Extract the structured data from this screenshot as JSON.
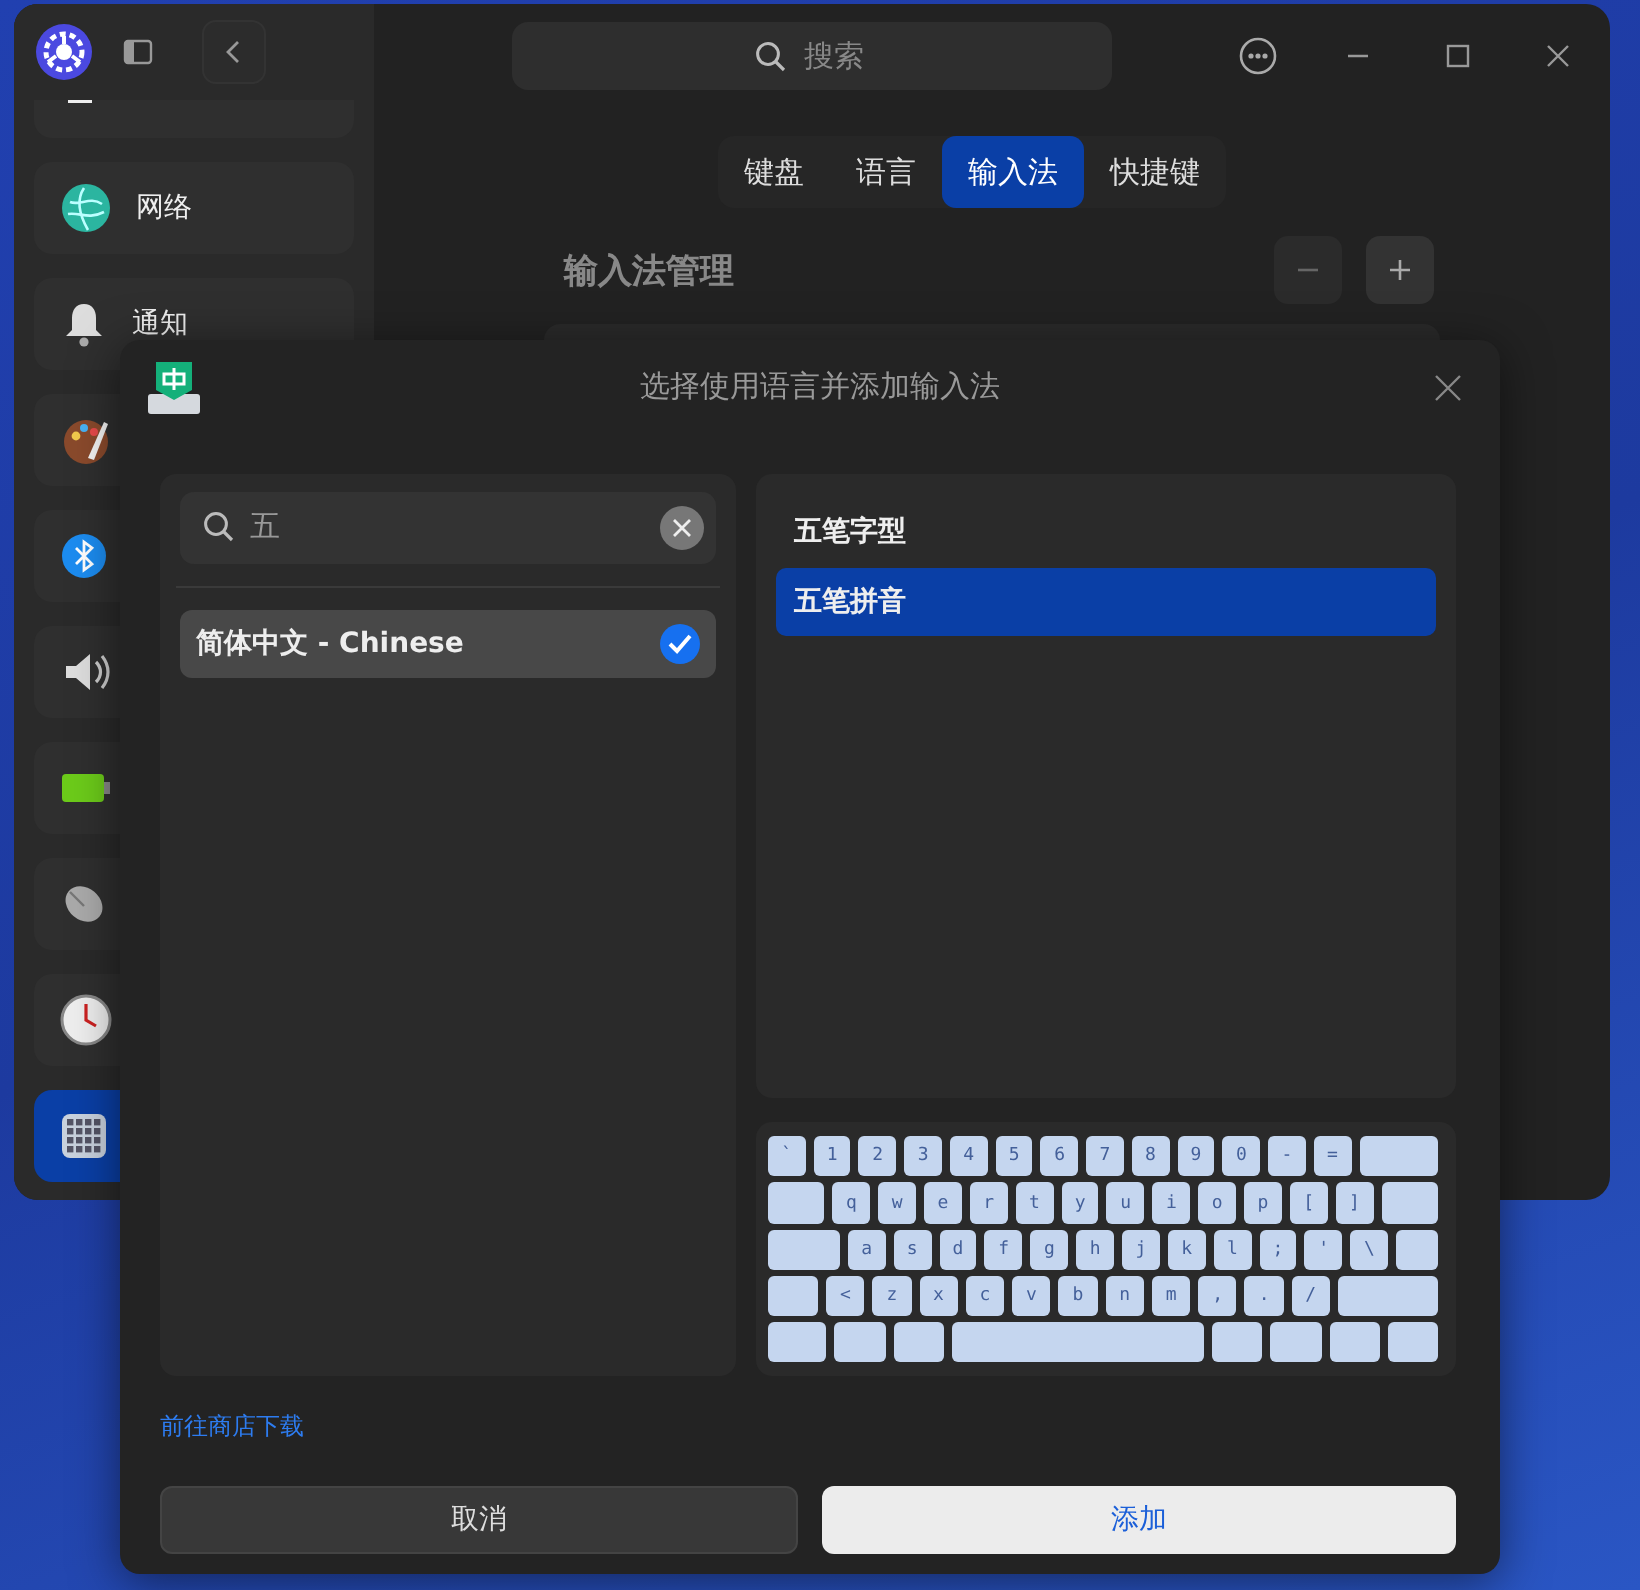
{
  "window": {
    "search": {
      "placeholder": "搜索"
    },
    "sidebar": {
      "items": [
        {
          "kind": "general",
          "selected": false
        },
        {
          "kind": "network",
          "label": "网络",
          "selected": false
        },
        {
          "kind": "notification",
          "label": "通知",
          "selected": false
        },
        {
          "kind": "appearance",
          "selected": false
        },
        {
          "kind": "bluetooth",
          "selected": false
        },
        {
          "kind": "sound",
          "selected": false
        },
        {
          "kind": "power",
          "selected": false
        },
        {
          "kind": "mouse",
          "selected": false
        },
        {
          "kind": "datetime",
          "selected": false
        },
        {
          "kind": "keyboard",
          "selected": true
        }
      ]
    },
    "tabs": [
      {
        "label": "键盘",
        "selected": false
      },
      {
        "label": "语言",
        "selected": false
      },
      {
        "label": "输入法",
        "selected": true
      },
      {
        "label": "快捷键",
        "selected": false
      }
    ],
    "section_title": "输入法管理"
  },
  "dialog": {
    "title": "选择使用语言并添加输入法",
    "search": {
      "value": "五"
    },
    "languages": [
      {
        "label": "简体中文 - Chinese",
        "selected": true,
        "checked": true
      }
    ],
    "input_methods": [
      {
        "label": "五笔字型",
        "selected": false
      },
      {
        "label": "五笔拼音",
        "selected": true
      }
    ],
    "keyboard": {
      "rows": [
        [
          {
            "kind": "key",
            "label": "`"
          },
          {
            "kind": "key",
            "label": "1"
          },
          {
            "kind": "key",
            "label": "2"
          },
          {
            "kind": "key",
            "label": "3"
          },
          {
            "kind": "key",
            "label": "4"
          },
          {
            "kind": "key",
            "label": "5"
          },
          {
            "kind": "key",
            "label": "6"
          },
          {
            "kind": "key",
            "label": "7"
          },
          {
            "kind": "key",
            "label": "8"
          },
          {
            "kind": "key",
            "label": "9"
          },
          {
            "kind": "key",
            "label": "0"
          },
          {
            "kind": "key",
            "label": "-"
          },
          {
            "kind": "key",
            "label": "="
          },
          {
            "kind": "backspace"
          }
        ],
        [
          {
            "kind": "tab"
          },
          {
            "kind": "key",
            "label": "q"
          },
          {
            "kind": "key",
            "label": "w"
          },
          {
            "kind": "key",
            "label": "e"
          },
          {
            "kind": "key",
            "label": "r"
          },
          {
            "kind": "key",
            "label": "t"
          },
          {
            "kind": "key",
            "label": "y"
          },
          {
            "kind": "key",
            "label": "u"
          },
          {
            "kind": "key",
            "label": "i"
          },
          {
            "kind": "key",
            "label": "o"
          },
          {
            "kind": "key",
            "label": "p"
          },
          {
            "kind": "key",
            "label": "["
          },
          {
            "kind": "key",
            "label": "]"
          },
          {
            "kind": "enter"
          }
        ],
        [
          {
            "kind": "caps"
          },
          {
            "kind": "key",
            "label": "a"
          },
          {
            "kind": "key",
            "label": "s"
          },
          {
            "kind": "key",
            "label": "d"
          },
          {
            "kind": "key",
            "label": "f"
          },
          {
            "kind": "key",
            "label": "g"
          },
          {
            "kind": "key",
            "label": "h"
          },
          {
            "kind": "key",
            "label": "j"
          },
          {
            "kind": "key",
            "label": "k"
          },
          {
            "kind": "key",
            "label": "l"
          },
          {
            "kind": "key",
            "label": ";"
          },
          {
            "kind": "key",
            "label": "'"
          },
          {
            "kind": "key",
            "label": "\\"
          },
          {
            "kind": "enter-low"
          }
        ],
        [
          {
            "kind": "shift"
          },
          {
            "kind": "key",
            "label": "<"
          },
          {
            "kind": "key",
            "label": "z"
          },
          {
            "kind": "key",
            "label": "x"
          },
          {
            "kind": "key",
            "label": "c"
          },
          {
            "kind": "key",
            "label": "v"
          },
          {
            "kind": "key",
            "label": "b"
          },
          {
            "kind": "key",
            "label": "n"
          },
          {
            "kind": "key",
            "label": "m"
          },
          {
            "kind": "key",
            "label": ","
          },
          {
            "kind": "key",
            "label": "."
          },
          {
            "kind": "key",
            "label": "/"
          },
          {
            "kind": "shift-right"
          }
        ],
        [
          {
            "kind": "ctrl"
          },
          {
            "kind": "mod"
          },
          {
            "kind": "mod"
          },
          {
            "kind": "space"
          },
          {
            "kind": "mod"
          },
          {
            "kind": "mod"
          },
          {
            "kind": "mod"
          },
          {
            "kind": "mod"
          }
        ]
      ]
    },
    "store_link": "前往商店下载",
    "buttons": [
      {
        "kind": "cancel",
        "label": "取消"
      },
      {
        "kind": "confirm",
        "label": "添加"
      }
    ]
  }
}
